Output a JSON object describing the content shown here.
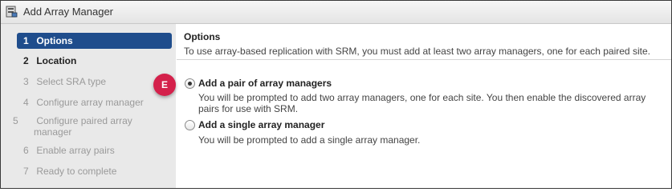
{
  "window": {
    "title": "Add Array Manager"
  },
  "steps": [
    {
      "num": "1",
      "label": "Options",
      "state": "active"
    },
    {
      "num": "2",
      "label": "Location",
      "state": "next"
    },
    {
      "num": "3",
      "label": "Select SRA type",
      "state": "disabled"
    },
    {
      "num": "4",
      "label": "Configure array manager",
      "state": "disabled"
    },
    {
      "num": "5",
      "label": "Configure paired array manager",
      "state": "disabled"
    },
    {
      "num": "6",
      "label": "Enable array pairs",
      "state": "disabled"
    },
    {
      "num": "7",
      "label": "Ready to complete",
      "state": "disabled"
    }
  ],
  "main": {
    "title": "Options",
    "description": "To use array-based replication with SRM, you must add at least two array managers, one for each paired site.",
    "options": [
      {
        "label": "Add a pair of array managers",
        "description": "You will be prompted to add two array managers, one for each site. You then enable the discovered array pairs for use with SRM.",
        "selected": true
      },
      {
        "label": "Add a single array manager",
        "description": "You will be prompted to add a single array manager.",
        "selected": false
      }
    ]
  },
  "callout": {
    "label": "E",
    "color": "#d4214b"
  }
}
